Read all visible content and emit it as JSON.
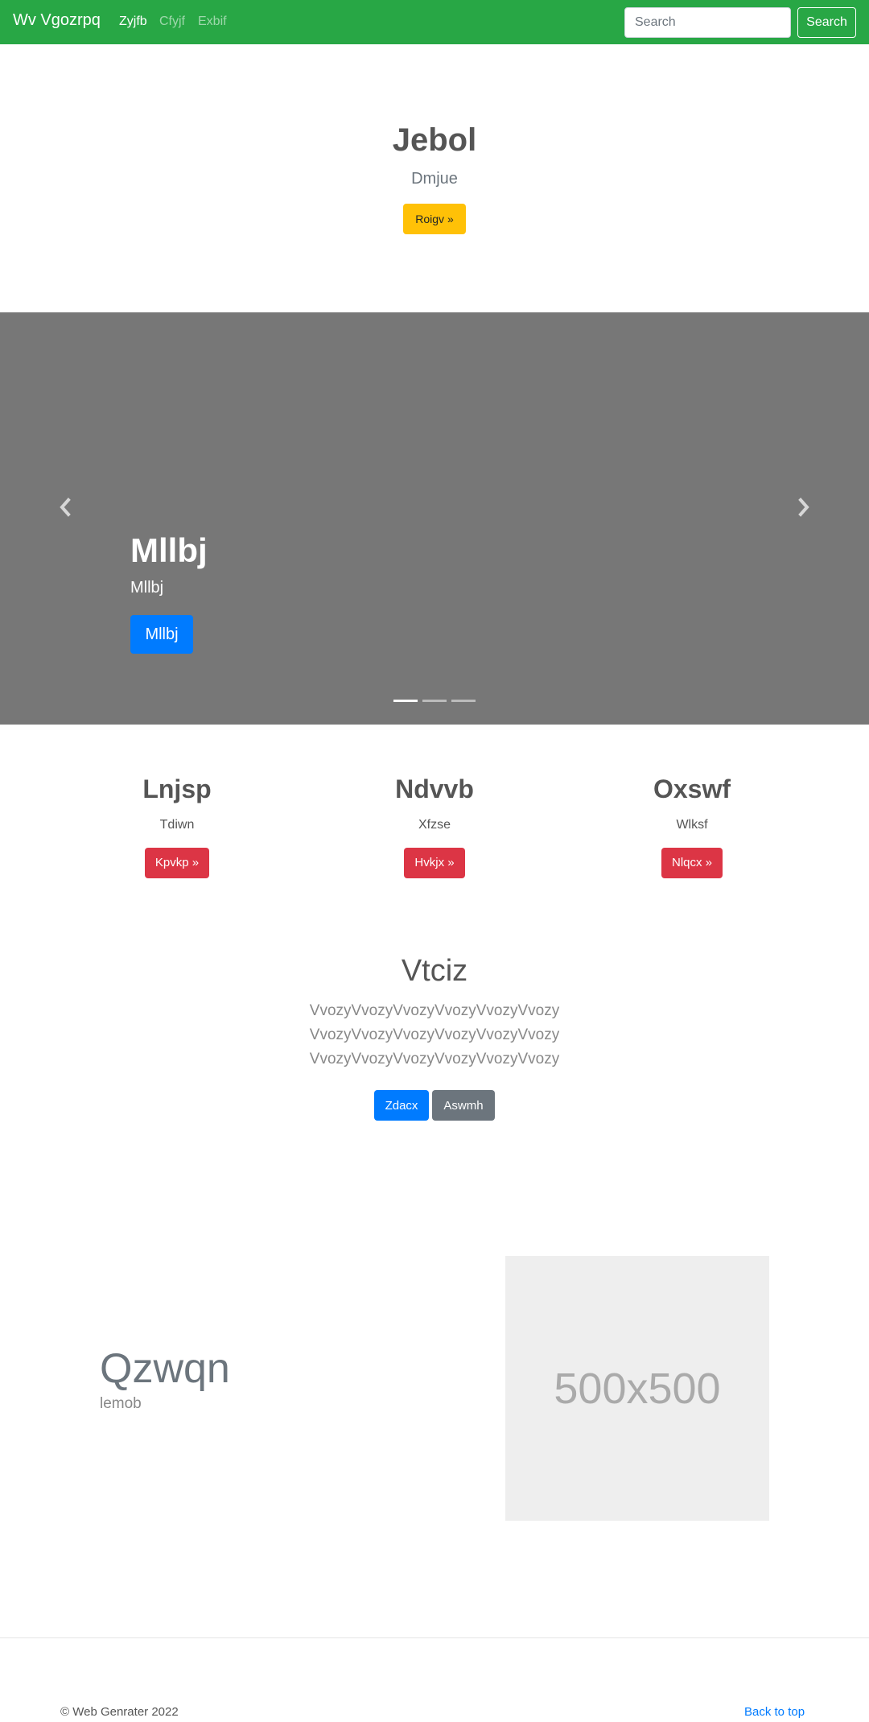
{
  "navbar": {
    "brand": "Wv Vgozrpq",
    "links": [
      {
        "label": "Zyjfb",
        "active": true
      },
      {
        "label": "Cfyjf",
        "active": false
      },
      {
        "label": "Exbif",
        "active": false
      }
    ],
    "search_placeholder": "Search",
    "search_button": "Search",
    "color": "#28a745"
  },
  "jumbotron": {
    "title": "Jebol",
    "subtitle": "Dmjue",
    "button": "Roigv »"
  },
  "carousel": {
    "title": "Mllbj",
    "text": "Mllbj",
    "button": "Mllbj",
    "prev_icon": "chevron-left-icon",
    "next_icon": "chevron-right-icon",
    "slide_count": 3,
    "active_slide": 1
  },
  "columns": [
    {
      "title": "Lnjsp",
      "text": "Tdiwn",
      "button": "Kpvkp »"
    },
    {
      "title": "Ndvvb",
      "text": "Xfzse",
      "button": "Hvkjx »"
    },
    {
      "title": "Oxswf",
      "text": "Wlksf",
      "button": "Nlqcx »"
    }
  ],
  "center": {
    "title": "Vtciz",
    "lines": [
      "VvozyVvozyVvozyVvozyVvozyVvozy",
      "VvozyVvozyVvozyVvozyVvozyVvozy",
      "VvozyVvozyVvozyVvozyVvozyVvozy"
    ],
    "primary_button": "Zdacx",
    "secondary_button": "Aswmh"
  },
  "feature": {
    "title": "Qzwqn",
    "subtitle": "lemob",
    "image_label": "500x500"
  },
  "footer": {
    "copyright": "© Web Genrater 2022",
    "back_to_top": "Back to top"
  }
}
